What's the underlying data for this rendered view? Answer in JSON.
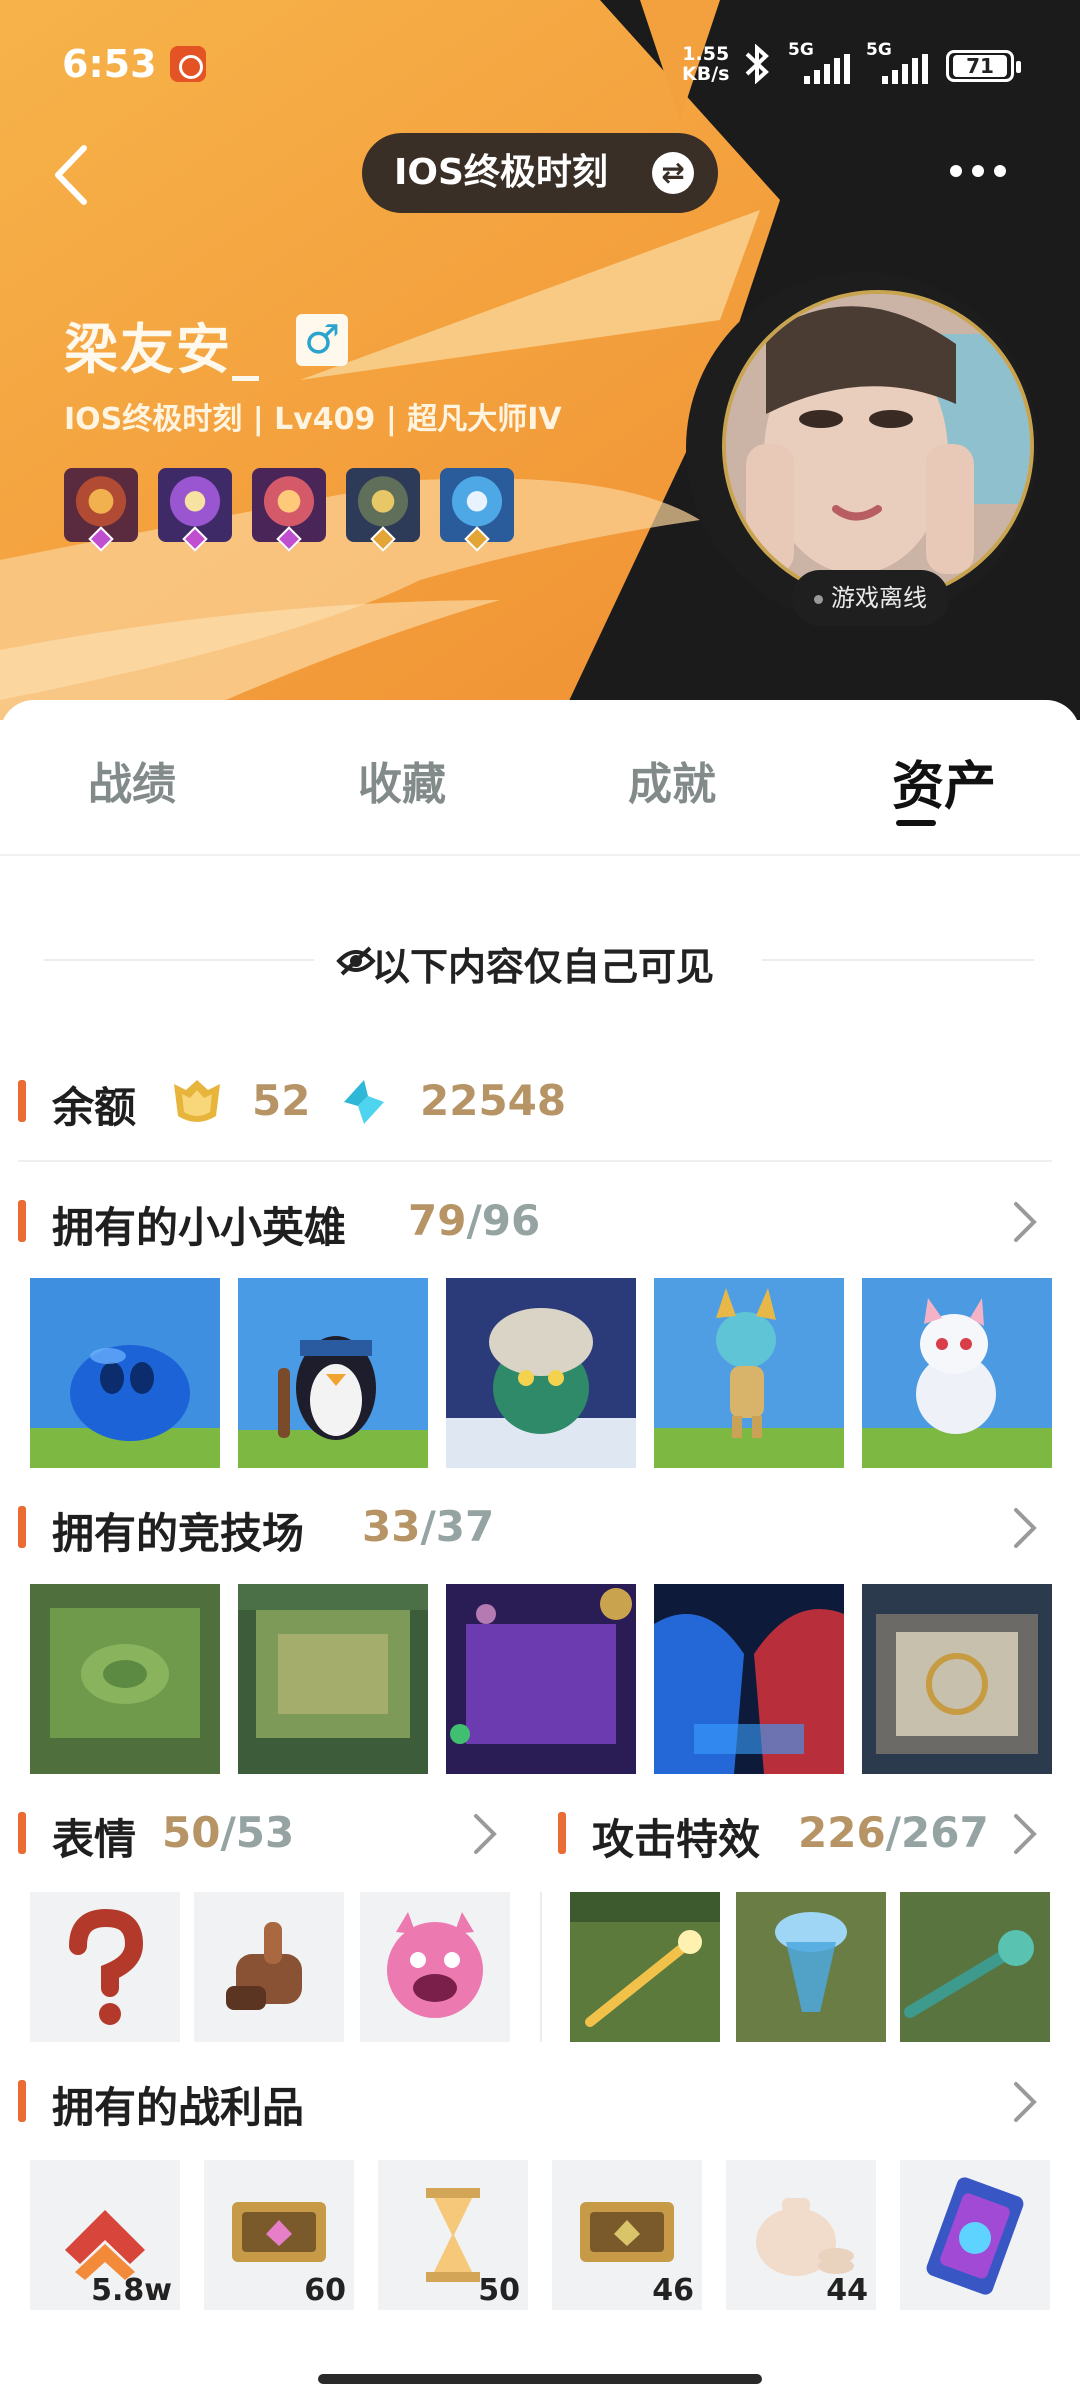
{
  "status_bar": {
    "time": "6:53",
    "net_speed_value": "1.55",
    "net_speed_unit": "KB/s",
    "signal1_label": "5G",
    "signal2_label": "5G",
    "battery": "71"
  },
  "header": {
    "title": "IOS终极时刻",
    "username": "梁友安_",
    "gender_symbol": "♂",
    "subline": "IOS终极时刻 | Lv409 | 超凡大师IV",
    "online_status": "游戏离线"
  },
  "tabs": [
    "战绩",
    "收藏",
    "成就",
    "资产"
  ],
  "notice": "以下内容仅自己可见",
  "balance": {
    "label": "余额",
    "gold_value": "52",
    "gem_value": "22548"
  },
  "legends": {
    "title": "拥有的小小英雄",
    "owned": "79",
    "total": "/96"
  },
  "arenas": {
    "title": "拥有的竞技场",
    "owned": "33",
    "total": "/37"
  },
  "emotes": {
    "title": "表情",
    "owned": "50",
    "total": "/53"
  },
  "booms": {
    "title": "攻击特效",
    "owned": "226",
    "total": "/267"
  },
  "loot": {
    "title": "拥有的战利品",
    "counts": [
      "5.8w",
      "60",
      "50",
      "46",
      "44",
      ""
    ]
  },
  "colors": {
    "accent": "#ea6b34",
    "header_orange": "#f3a23b",
    "header_dark": "#1d1d1d",
    "count_owned": "#b69465",
    "count_total": "#96a3a3"
  },
  "icons": [
    "back-icon",
    "swap-icon",
    "more-icon",
    "bluetooth-icon",
    "hidden-eye-icon",
    "gold-coin-icon",
    "gem-icon",
    "chevron-right-icon"
  ]
}
